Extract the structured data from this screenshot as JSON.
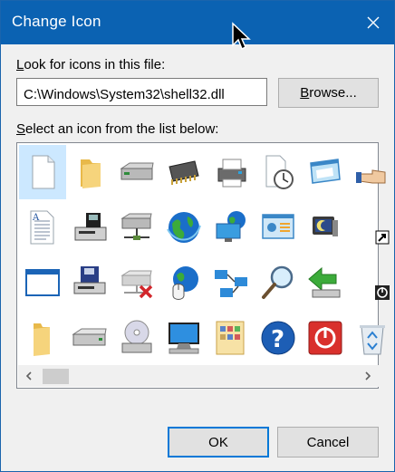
{
  "window": {
    "title": "Change Icon"
  },
  "file_section": {
    "label_prefix": "L",
    "label_rest": "ook for icons in this file:",
    "path_value": "C:\\Windows\\System32\\shell32.dll",
    "browse_prefix": "B",
    "browse_rest": "rowse..."
  },
  "list_section": {
    "label_prefix": "S",
    "label_rest": "elect an icon from the list below:",
    "icons": [
      [
        "blank-document-icon",
        "folder-icon",
        "drive-icon",
        "memory-chip-icon",
        "printer-icon",
        "clock-document-icon",
        "window-icon",
        "hand-pointer-icon"
      ],
      [
        "text-document-icon",
        "floppy-computer-icon",
        "network-drive-icon",
        "globe-icon",
        "network-globe-icon",
        "control-panel-icon",
        "moon-screen-icon",
        "shortcut-arrow-icon"
      ],
      [
        "blank-window-icon",
        "floppy-drive-icon",
        "disconnected-drive-icon",
        "mouse-globe-icon",
        "network-diagram-icon",
        "search-magnifier-icon",
        "green-arrow-drive-icon",
        "power-small-icon"
      ],
      [
        "open-folder-icon",
        "drive-plain-icon",
        "cd-drive-icon",
        "desktop-computer-icon",
        "file-thumbnails-icon",
        "help-icon",
        "power-button-icon",
        "recycle-bin-icon"
      ]
    ],
    "selected_index": 0
  },
  "buttons": {
    "ok_label": "OK",
    "cancel_label": "Cancel"
  },
  "colors": {
    "titlebar": "#0b62b2",
    "selection": "#cce8ff",
    "accent": "#0078d7"
  }
}
